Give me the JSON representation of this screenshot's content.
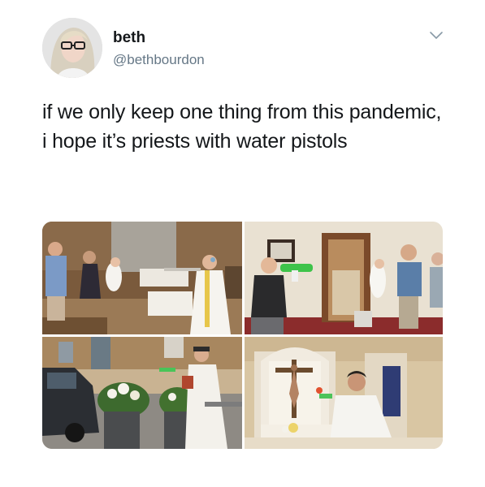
{
  "tweet": {
    "display_name": "beth",
    "handle": "@bethbourdon",
    "text": "if we only keep one thing from this pandemic, i hope it’s priests with water pistols"
  },
  "media": {
    "photos": [
      {
        "name": "photo-baptism-church-interior"
      },
      {
        "name": "photo-priest-green-water-gun"
      },
      {
        "name": "photo-priest-outdoor-car"
      },
      {
        "name": "photo-priest-altar-crucifix"
      }
    ]
  },
  "icons": {
    "menu": "chevron-down-icon"
  },
  "colors": {
    "text": "#14171a",
    "secondary": "#657786"
  }
}
